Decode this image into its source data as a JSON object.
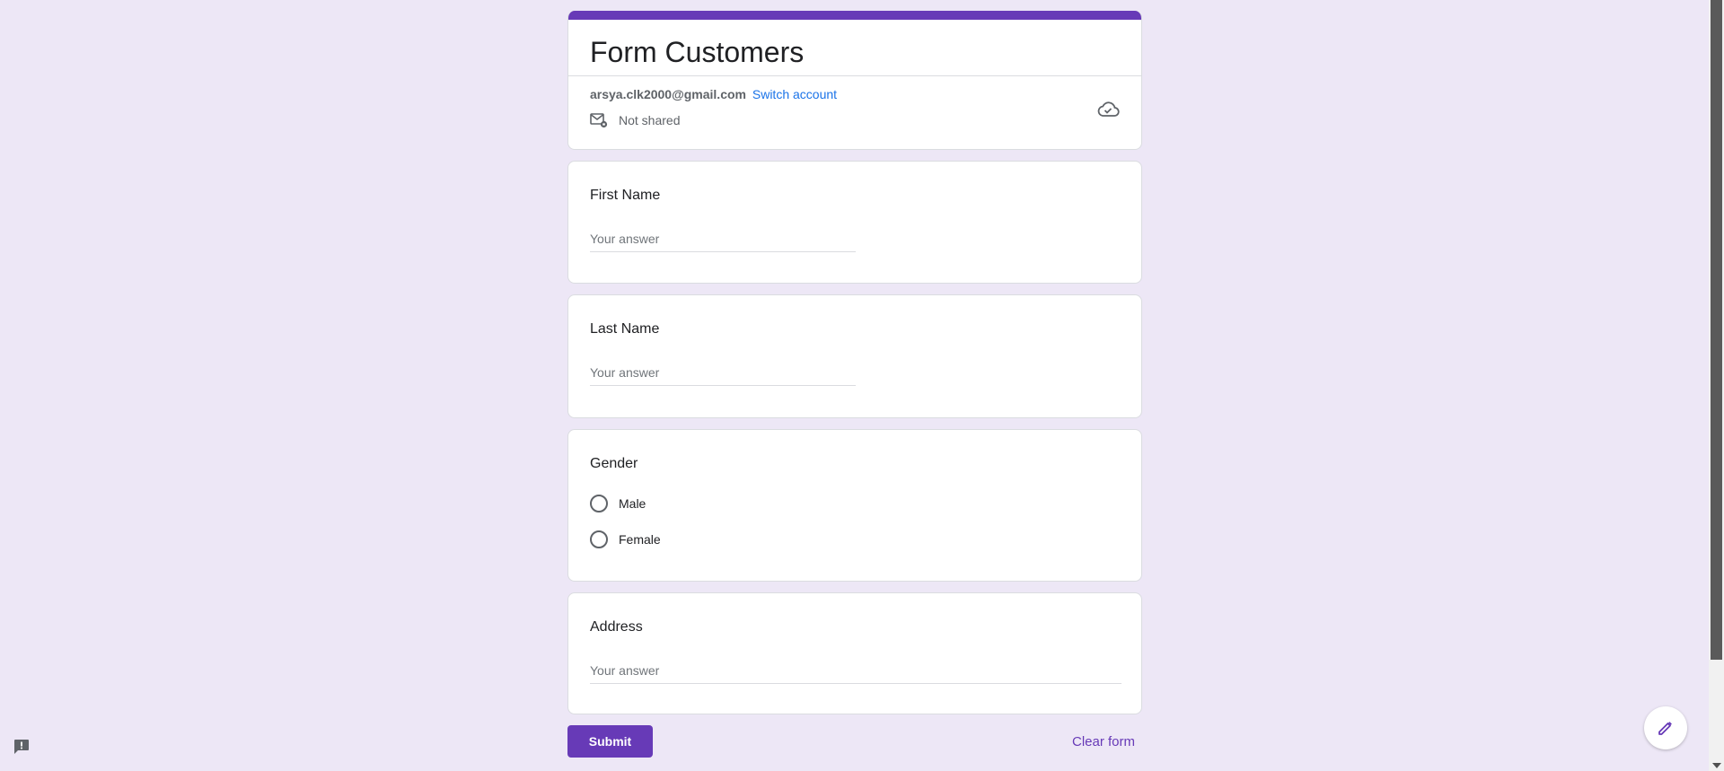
{
  "form": {
    "title": "Form Customers",
    "account_email": "arsya.clk2000@gmail.com",
    "switch_account": "Switch account",
    "shared_status": "Not shared"
  },
  "questions": {
    "first_name": {
      "label": "First Name",
      "placeholder": "Your answer"
    },
    "last_name": {
      "label": "Last Name",
      "placeholder": "Your answer"
    },
    "gender": {
      "label": "Gender",
      "options": [
        "Male",
        "Female"
      ]
    },
    "address": {
      "label": "Address",
      "placeholder": "Your answer"
    }
  },
  "actions": {
    "submit_label": "Submit",
    "clear_label": "Clear form"
  },
  "theme": {
    "accent": "#673ab7",
    "background": "#ede7f6",
    "link": "#1a73e8"
  },
  "icons": [
    "mail-lock-icon",
    "cloud-done-icon",
    "report-icon",
    "edit-pencil-icon"
  ]
}
